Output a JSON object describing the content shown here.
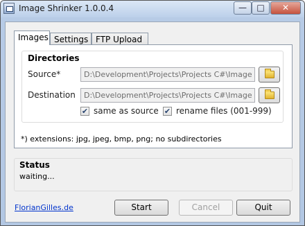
{
  "window": {
    "title": "Image Shrinker 1.0.0.4",
    "minimize": "—",
    "maximize": "□",
    "close": "✕"
  },
  "tabs": [
    {
      "label": "Images"
    },
    {
      "label": "Settings"
    },
    {
      "label": "FTP Upload"
    }
  ],
  "directories": {
    "title": "Directories",
    "source_label": "Source*",
    "source_value": "D:\\Development\\Projects\\Projects C#\\ImageShr",
    "destination_label": "Destination",
    "destination_value": "D:\\Development\\Projects\\Projects C#\\ImageShr",
    "same_as_source_label": "same as source",
    "same_as_source_checked": true,
    "rename_files_label": "rename files (001-999)",
    "rename_files_checked": true,
    "note": "*) extensions: jpg, jpeg, bmp, png; no subdirectories"
  },
  "status": {
    "title": "Status",
    "text": "waiting..."
  },
  "footer": {
    "link": "FlorianGilles.de",
    "start": "Start",
    "cancel": "Cancel",
    "quit": "Quit"
  }
}
